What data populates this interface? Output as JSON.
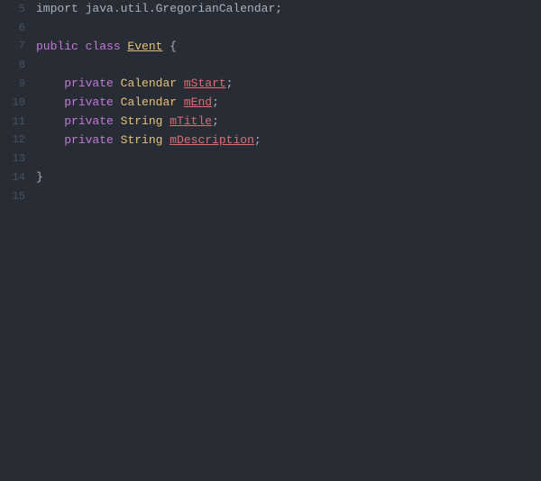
{
  "editor": {
    "background": "#282c34",
    "lines": [
      {
        "number": 5,
        "tokens": [
          {
            "text": "import java.util.GregorianCalendar;",
            "class": "import-text"
          }
        ]
      },
      {
        "number": 6,
        "tokens": []
      },
      {
        "number": 7,
        "tokens": [
          {
            "text": "public ",
            "class": "keyword"
          },
          {
            "text": "class ",
            "class": "keyword"
          },
          {
            "text": "Event",
            "class": "class-name-underline"
          },
          {
            "text": " {",
            "class": "punctuation"
          }
        ]
      },
      {
        "number": 8,
        "tokens": []
      },
      {
        "number": 9,
        "tokens": [
          {
            "text": "    "
          },
          {
            "text": "private ",
            "class": "keyword"
          },
          {
            "text": "Calendar ",
            "class": "type-name"
          },
          {
            "text": "mStart",
            "class": "variable-underline"
          },
          {
            "text": ";",
            "class": "punctuation"
          }
        ]
      },
      {
        "number": 10,
        "tokens": [
          {
            "text": "    "
          },
          {
            "text": "private ",
            "class": "keyword"
          },
          {
            "text": "Calendar ",
            "class": "type-name"
          },
          {
            "text": "mEnd",
            "class": "variable-underline"
          },
          {
            "text": ";",
            "class": "punctuation"
          }
        ]
      },
      {
        "number": 11,
        "tokens": [
          {
            "text": "    "
          },
          {
            "text": "private ",
            "class": "keyword"
          },
          {
            "text": "String ",
            "class": "type-name"
          },
          {
            "text": "mTitle",
            "class": "variable-underline"
          },
          {
            "text": ";",
            "class": "punctuation"
          }
        ]
      },
      {
        "number": 12,
        "tokens": [
          {
            "text": "    "
          },
          {
            "text": "private ",
            "class": "keyword"
          },
          {
            "text": "String ",
            "class": "type-name"
          },
          {
            "text": "mDescription",
            "class": "variable-underline"
          },
          {
            "text": ";",
            "class": "punctuation"
          }
        ]
      },
      {
        "number": 13,
        "tokens": []
      },
      {
        "number": 14,
        "tokens": [
          {
            "text": "}",
            "class": "punctuation"
          }
        ]
      },
      {
        "number": 15,
        "tokens": []
      }
    ]
  }
}
